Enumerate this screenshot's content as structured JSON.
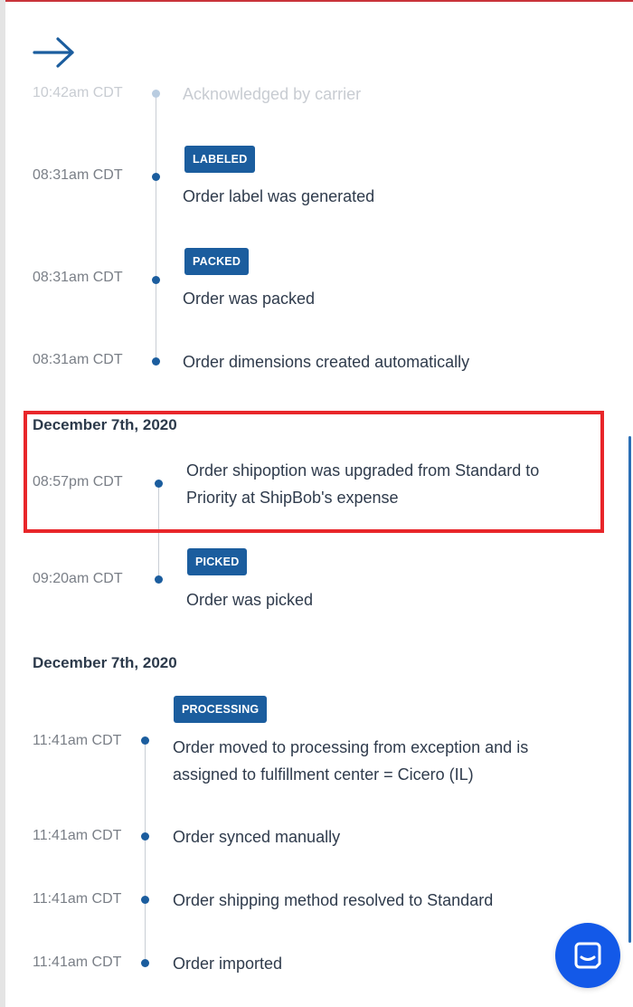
{
  "colors": {
    "badge_bg": "#1b5d9e",
    "highlight": "#e8262a",
    "chat_button": "#1359e8",
    "timeline_dot": "#1b5d9e"
  },
  "header": {
    "back_icon": "arrow-right-icon"
  },
  "events_top": [
    {
      "time": "10:42am CDT",
      "text": "Acknowledged by carrier",
      "badge": ""
    },
    {
      "time": "08:31am CDT",
      "text": "Order label was generated",
      "badge": "LABELED"
    },
    {
      "time": "08:31am CDT",
      "text": "Order was packed",
      "badge": "PACKED"
    },
    {
      "time": "08:31am CDT",
      "text": "Order dimensions created automatically",
      "badge": ""
    }
  ],
  "group1": {
    "date": "December 7th, 2020",
    "events": [
      {
        "time": "08:57pm CDT",
        "text_line1": "Order shipoption was upgraded from Standard to",
        "text_line2": "Priority at ShipBob's expense",
        "badge": ""
      },
      {
        "time": "09:20am CDT",
        "text": "Order was picked",
        "badge": "PICKED"
      }
    ]
  },
  "group2": {
    "date": "December 7th, 2020",
    "events": [
      {
        "time": "11:41am CDT",
        "text_line1": "Order moved to processing from exception and is",
        "text_line2": "assigned to fulfillment center = Cicero (IL)",
        "badge": "PROCESSING"
      },
      {
        "time": "11:41am CDT",
        "text": "Order synced manually",
        "badge": ""
      },
      {
        "time": "11:41am CDT",
        "text": "Order shipping method resolved to Standard",
        "badge": ""
      },
      {
        "time": "11:41am CDT",
        "text": "Order imported",
        "badge": ""
      }
    ]
  },
  "chat": {
    "icon": "chat-icon"
  }
}
